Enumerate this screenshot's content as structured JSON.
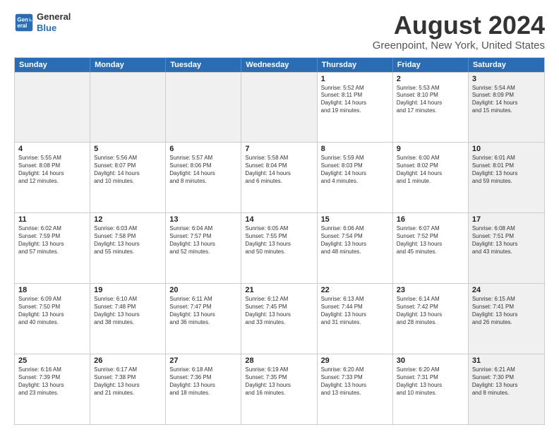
{
  "logo": {
    "line1": "General",
    "line2": "Blue"
  },
  "title": "August 2024",
  "subtitle": "Greenpoint, New York, United States",
  "weekdays": [
    "Sunday",
    "Monday",
    "Tuesday",
    "Wednesday",
    "Thursday",
    "Friday",
    "Saturday"
  ],
  "weeks": [
    [
      {
        "day": "",
        "info": "",
        "shaded": true
      },
      {
        "day": "",
        "info": "",
        "shaded": true
      },
      {
        "day": "",
        "info": "",
        "shaded": true
      },
      {
        "day": "",
        "info": "",
        "shaded": true
      },
      {
        "day": "1",
        "info": "Sunrise: 5:52 AM\nSunset: 8:11 PM\nDaylight: 14 hours\nand 19 minutes.",
        "shaded": false
      },
      {
        "day": "2",
        "info": "Sunrise: 5:53 AM\nSunset: 8:10 PM\nDaylight: 14 hours\nand 17 minutes.",
        "shaded": false
      },
      {
        "day": "3",
        "info": "Sunrise: 5:54 AM\nSunset: 8:09 PM\nDaylight: 14 hours\nand 15 minutes.",
        "shaded": true
      }
    ],
    [
      {
        "day": "4",
        "info": "Sunrise: 5:55 AM\nSunset: 8:08 PM\nDaylight: 14 hours\nand 12 minutes.",
        "shaded": false
      },
      {
        "day": "5",
        "info": "Sunrise: 5:56 AM\nSunset: 8:07 PM\nDaylight: 14 hours\nand 10 minutes.",
        "shaded": false
      },
      {
        "day": "6",
        "info": "Sunrise: 5:57 AM\nSunset: 8:06 PM\nDaylight: 14 hours\nand 8 minutes.",
        "shaded": false
      },
      {
        "day": "7",
        "info": "Sunrise: 5:58 AM\nSunset: 8:04 PM\nDaylight: 14 hours\nand 6 minutes.",
        "shaded": false
      },
      {
        "day": "8",
        "info": "Sunrise: 5:59 AM\nSunset: 8:03 PM\nDaylight: 14 hours\nand 4 minutes.",
        "shaded": false
      },
      {
        "day": "9",
        "info": "Sunrise: 6:00 AM\nSunset: 8:02 PM\nDaylight: 14 hours\nand 1 minute.",
        "shaded": false
      },
      {
        "day": "10",
        "info": "Sunrise: 6:01 AM\nSunset: 8:01 PM\nDaylight: 13 hours\nand 59 minutes.",
        "shaded": true
      }
    ],
    [
      {
        "day": "11",
        "info": "Sunrise: 6:02 AM\nSunset: 7:59 PM\nDaylight: 13 hours\nand 57 minutes.",
        "shaded": false
      },
      {
        "day": "12",
        "info": "Sunrise: 6:03 AM\nSunset: 7:58 PM\nDaylight: 13 hours\nand 55 minutes.",
        "shaded": false
      },
      {
        "day": "13",
        "info": "Sunrise: 6:04 AM\nSunset: 7:57 PM\nDaylight: 13 hours\nand 52 minutes.",
        "shaded": false
      },
      {
        "day": "14",
        "info": "Sunrise: 6:05 AM\nSunset: 7:55 PM\nDaylight: 13 hours\nand 50 minutes.",
        "shaded": false
      },
      {
        "day": "15",
        "info": "Sunrise: 6:06 AM\nSunset: 7:54 PM\nDaylight: 13 hours\nand 48 minutes.",
        "shaded": false
      },
      {
        "day": "16",
        "info": "Sunrise: 6:07 AM\nSunset: 7:52 PM\nDaylight: 13 hours\nand 45 minutes.",
        "shaded": false
      },
      {
        "day": "17",
        "info": "Sunrise: 6:08 AM\nSunset: 7:51 PM\nDaylight: 13 hours\nand 43 minutes.",
        "shaded": true
      }
    ],
    [
      {
        "day": "18",
        "info": "Sunrise: 6:09 AM\nSunset: 7:50 PM\nDaylight: 13 hours\nand 40 minutes.",
        "shaded": false
      },
      {
        "day": "19",
        "info": "Sunrise: 6:10 AM\nSunset: 7:48 PM\nDaylight: 13 hours\nand 38 minutes.",
        "shaded": false
      },
      {
        "day": "20",
        "info": "Sunrise: 6:11 AM\nSunset: 7:47 PM\nDaylight: 13 hours\nand 36 minutes.",
        "shaded": false
      },
      {
        "day": "21",
        "info": "Sunrise: 6:12 AM\nSunset: 7:45 PM\nDaylight: 13 hours\nand 33 minutes.",
        "shaded": false
      },
      {
        "day": "22",
        "info": "Sunrise: 6:13 AM\nSunset: 7:44 PM\nDaylight: 13 hours\nand 31 minutes.",
        "shaded": false
      },
      {
        "day": "23",
        "info": "Sunrise: 6:14 AM\nSunset: 7:42 PM\nDaylight: 13 hours\nand 28 minutes.",
        "shaded": false
      },
      {
        "day": "24",
        "info": "Sunrise: 6:15 AM\nSunset: 7:41 PM\nDaylight: 13 hours\nand 26 minutes.",
        "shaded": true
      }
    ],
    [
      {
        "day": "25",
        "info": "Sunrise: 6:16 AM\nSunset: 7:39 PM\nDaylight: 13 hours\nand 23 minutes.",
        "shaded": false
      },
      {
        "day": "26",
        "info": "Sunrise: 6:17 AM\nSunset: 7:38 PM\nDaylight: 13 hours\nand 21 minutes.",
        "shaded": false
      },
      {
        "day": "27",
        "info": "Sunrise: 6:18 AM\nSunset: 7:36 PM\nDaylight: 13 hours\nand 18 minutes.",
        "shaded": false
      },
      {
        "day": "28",
        "info": "Sunrise: 6:19 AM\nSunset: 7:35 PM\nDaylight: 13 hours\nand 16 minutes.",
        "shaded": false
      },
      {
        "day": "29",
        "info": "Sunrise: 6:20 AM\nSunset: 7:33 PM\nDaylight: 13 hours\nand 13 minutes.",
        "shaded": false
      },
      {
        "day": "30",
        "info": "Sunrise: 6:20 AM\nSunset: 7:31 PM\nDaylight: 13 hours\nand 10 minutes.",
        "shaded": false
      },
      {
        "day": "31",
        "info": "Sunrise: 6:21 AM\nSunset: 7:30 PM\nDaylight: 13 hours\nand 8 minutes.",
        "shaded": true
      }
    ]
  ]
}
